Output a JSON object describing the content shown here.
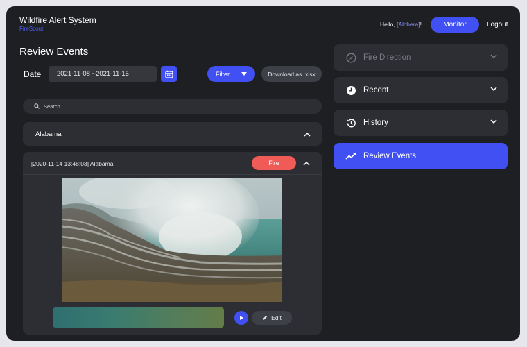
{
  "header": {
    "app_title": "Wildfire Alert System",
    "app_subtitle": "FireScout",
    "greeting_prefix": "Hello, ",
    "user_name": "[Alchera]",
    "greeting_suffix": "!",
    "monitor_label": "Monitor",
    "logout_label": "Logout"
  },
  "main": {
    "page_title": "Review Events",
    "date_label": "Date",
    "date_range": "2021-11-08 ~2021-11-15",
    "filter_label": "Filter",
    "download_label": "Download as .xlsx",
    "search_placeholder": "Search",
    "state_group": "Alabama",
    "event": {
      "title": "[2020-11-14 13:48:03] Alabama",
      "badge": "Fire",
      "edit_label": "Edit"
    }
  },
  "sidebar": {
    "items": [
      {
        "label": "Fire Direction",
        "icon": "compass-icon",
        "state": "disabled"
      },
      {
        "label": "Recent",
        "icon": "clock-icon",
        "state": "normal"
      },
      {
        "label": "History",
        "icon": "history-icon",
        "state": "normal"
      },
      {
        "label": "Review Events",
        "icon": "trend-icon",
        "state": "active"
      }
    ]
  },
  "colors": {
    "accent": "#4150f2",
    "fire_badge": "#f05a57",
    "background": "#1e1f23",
    "card": "#2c2e33"
  }
}
